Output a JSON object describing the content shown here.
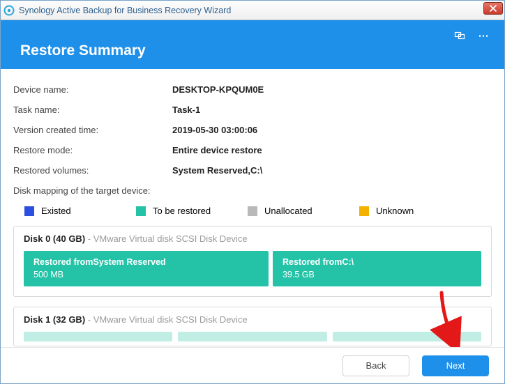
{
  "window": {
    "title": "Synology Active Backup for Business Recovery Wizard"
  },
  "header": {
    "title": "Restore Summary"
  },
  "summary": {
    "device_name_label": "Device name:",
    "device_name_value": "DESKTOP-KPQUM0E",
    "task_name_label": "Task name:",
    "task_name_value": "Task-1",
    "version_time_label": "Version created time:",
    "version_time_value": "2019-05-30 03:00:06",
    "restore_mode_label": "Restore mode:",
    "restore_mode_value": "Entire device restore",
    "restored_volumes_label": "Restored volumes:",
    "restored_volumes_value": "System Reserved,C:\\"
  },
  "mapping": {
    "section_label": "Disk mapping of the target device:",
    "legend": {
      "existed": "Existed",
      "to_be_restored": "To be restored",
      "unallocated": "Unallocated",
      "unknown": "Unknown"
    }
  },
  "disks": [
    {
      "name": "Disk 0 (40 GB)",
      "desc": "- VMware Virtual disk SCSI Disk Device",
      "partitions": [
        {
          "title": "Restored fromSystem Reserved",
          "size": "500 MB"
        },
        {
          "title": "Restored fromC:\\",
          "size": "39.5 GB"
        }
      ]
    },
    {
      "name": "Disk 1 (32 GB)",
      "desc": "- VMware Virtual disk SCSI Disk Device"
    }
  ],
  "footer": {
    "back": "Back",
    "next": "Next"
  }
}
